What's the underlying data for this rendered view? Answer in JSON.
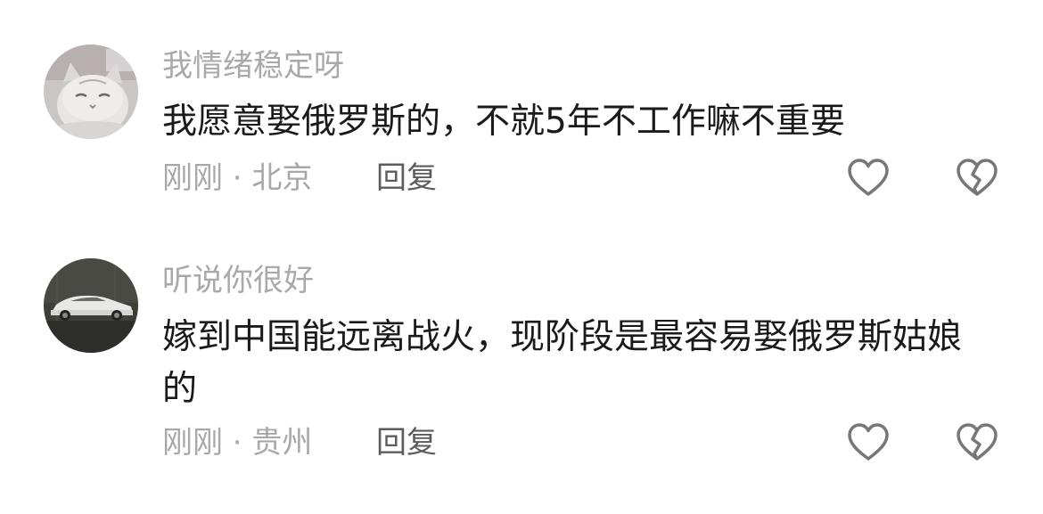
{
  "comments": [
    {
      "username": "我情绪稳定呀",
      "text": "我愿意娶俄罗斯的，不就5年不工作嘛不重要",
      "meta": "刚刚 · 北京",
      "reply_label": "回复",
      "avatar_icon": "cat-avatar",
      "like_icon": "heart-outline-icon",
      "dislike_icon": "broken-heart-icon"
    },
    {
      "username": "听说你很好",
      "text": "嫁到中国能远离战火，现阶段是最容易娶俄罗斯姑娘的",
      "meta": "刚刚 · 贵州",
      "reply_label": "回复",
      "avatar_icon": "car-avatar",
      "like_icon": "heart-outline-icon",
      "dislike_icon": "broken-heart-icon"
    }
  ],
  "colors": {
    "username": "#a9a9a9",
    "text": "#1a1a1a",
    "meta": "#a8a8a8",
    "reply": "#5c5c5c",
    "icon_stroke": "#777777"
  }
}
